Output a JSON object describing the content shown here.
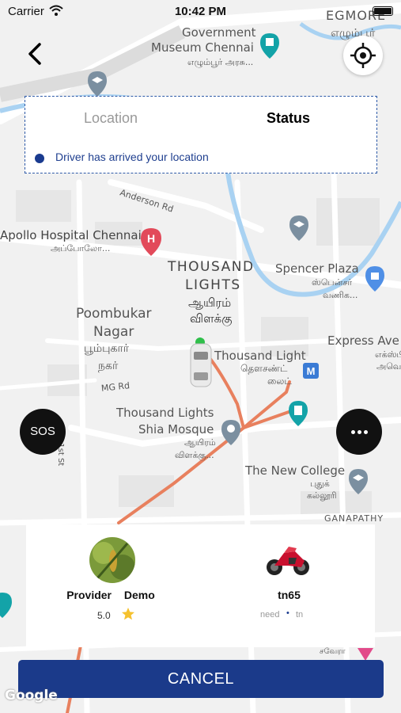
{
  "status_bar": {
    "carrier": "Carrier",
    "time": "10:42 PM"
  },
  "map": {
    "labels": {
      "egmore": "EGMORE",
      "egmore_ta": "எழும்பூர்",
      "museum": "Government",
      "museum_2": "Museum Chennai",
      "museum_ta": "எழும்பூர் அரசு...",
      "anderson": "Anderson Rd",
      "apollo": "Apollo Hospital Chennai",
      "apollo_ta": "அப்போலோ...",
      "thousand": "THOUSAND",
      "lights": "LIGHTS",
      "thousand_ta": "ஆயிரம்",
      "thousand_ta_2": "விளக்கு",
      "spencer": "Spencer Plaza",
      "spencer_ta": "ஸ்பென்சர்",
      "spencer_ta_2": "வணிக...",
      "poombukar": "Poombukar",
      "nagar": "Nagar",
      "poombukar_ta": "பூம்புகார்",
      "nagar_ta": "நகர்",
      "tl_metro": "Thousand Light",
      "tl_metro_ta": "தௌசண்ட்",
      "tl_metro_ta_2": "லைட்",
      "express": "Express Ave",
      "express_ta": "எக்ஸ்பிர",
      "express_ta_2": "அவென்",
      "mg_rd": "MG Rd",
      "mosque": "Thousand Lights",
      "mosque_2": "Shia Mosque",
      "mosque_ta": "ஆயிரம்",
      "mosque_ta_2": "விளக்கு...",
      "new_college": "The New College",
      "new_college_ta": "புதுக்",
      "new_college_ta_2": "கல்லூரி",
      "ganapathy": "GANAPATHY",
      "first_st": "1st St",
      "google": "Google",
      "savera": "சவேரா"
    }
  },
  "status_card": {
    "tab_location": "Location",
    "tab_status": "Status",
    "message": "Driver has arrived your location"
  },
  "buttons": {
    "sos": "SOS",
    "cancel": "CANCEL"
  },
  "provider": {
    "name": "Provider Demo",
    "rating": "5.0"
  },
  "vehicle": {
    "number": "tn65",
    "model": "need",
    "separator": "•",
    "type": "tn"
  },
  "colors": {
    "accent": "#1b3a8a",
    "route": "#e8805e",
    "river": "#a9d2f2",
    "star": "#f5c12e"
  }
}
